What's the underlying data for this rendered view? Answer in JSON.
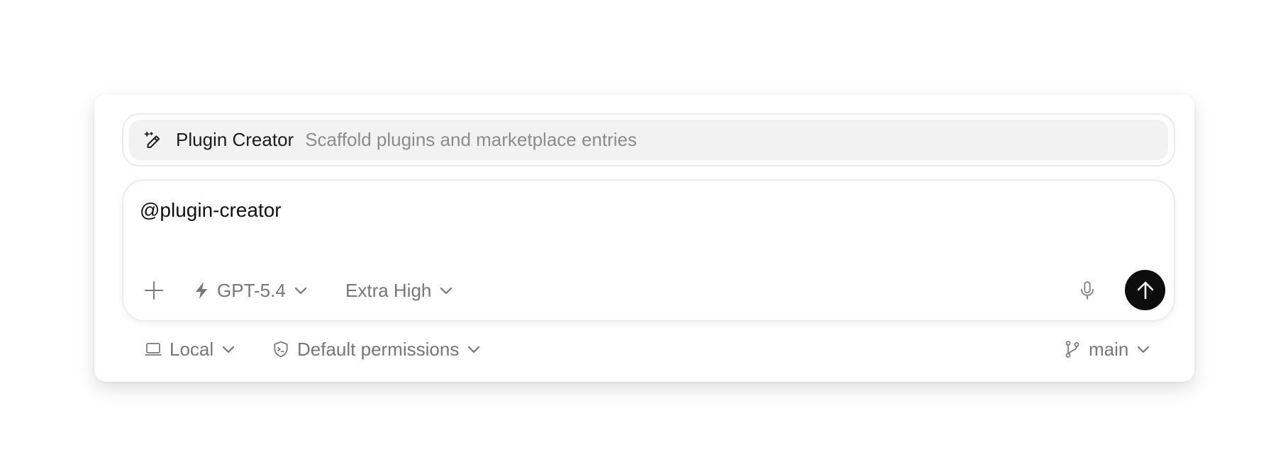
{
  "suggestion": {
    "icon": "pencil-sparkle-icon",
    "title": "Plugin Creator",
    "description": "Scaffold plugins and marketplace entries"
  },
  "composer": {
    "input_value": "@plugin-creator",
    "model_label": "GPT-5.4",
    "effort_label": "Extra High",
    "send_button_color": "#0d0d0d"
  },
  "footer": {
    "environment_label": "Local",
    "permissions_label": "Default permissions",
    "branch_label": "main"
  },
  "colors": {
    "text_primary": "#1c1c1c",
    "text_muted": "#777777",
    "suggestion_bg": "#f2f2f2"
  }
}
